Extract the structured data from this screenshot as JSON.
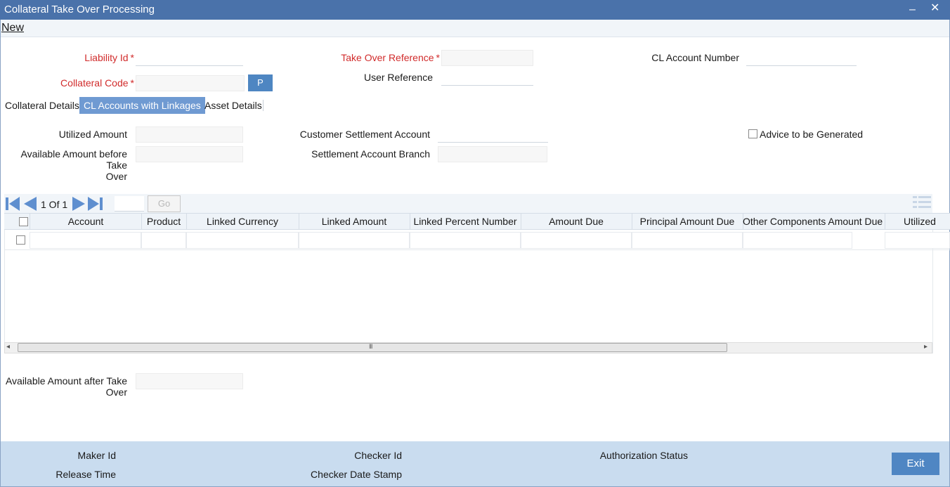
{
  "window": {
    "title": "Collateral Take Over Processing",
    "minimize_glyph": "‒",
    "close_glyph": "✕"
  },
  "menu": {
    "new_label": "New"
  },
  "header_fields": {
    "liability_id_label": "Liability Id",
    "take_over_reference_label": "Take Over Reference",
    "cl_account_number_label": "CL Account Number",
    "collateral_code_label": "Collateral Code",
    "user_reference_label": "User Reference",
    "p_button_label": "P",
    "required_marker": "*"
  },
  "tabs": [
    {
      "label": "Collateral Details",
      "active": false
    },
    {
      "label": "CL Accounts with Linkages",
      "active": true
    },
    {
      "label": "Asset Details",
      "active": false
    }
  ],
  "details": {
    "utilized_amount_label": "Utilized Amount",
    "available_before_line1": "Available Amount before Take",
    "available_before_line2": "Over",
    "customer_settlement_account_label": "Customer Settlement Account",
    "settlement_account_branch_label": "Settlement Account Branch",
    "advice_label": "Advice to be Generated",
    "advice_checked": false
  },
  "grid": {
    "pager_text": "1 Of 1",
    "go_label": "Go",
    "columns": [
      "Account",
      "Product",
      "Linked Currency",
      "Linked Amount",
      "Linked Percent Number",
      "Amount Due",
      "Principal Amount Due",
      "Other Components Amount Due",
      "Utilized"
    ],
    "scroll_glyph": "III",
    "scroll_left_glyph": "◂",
    "scroll_right_glyph": "▸"
  },
  "after": {
    "available_after_line1": "Available Amount after Take",
    "available_after_line2": "Over"
  },
  "footer": {
    "maker_id_label": "Maker Id",
    "checker_id_label": "Checker Id",
    "authorization_status_label": "Authorization Status",
    "release_time_label": "Release Time",
    "checker_date_stamp_label": "Checker Date Stamp",
    "exit_label": "Exit"
  },
  "colors": {
    "titlebar": "#4a72aa",
    "accent": "#4e86c2",
    "required": "#d12b2b",
    "footer": "#c9dcef"
  }
}
